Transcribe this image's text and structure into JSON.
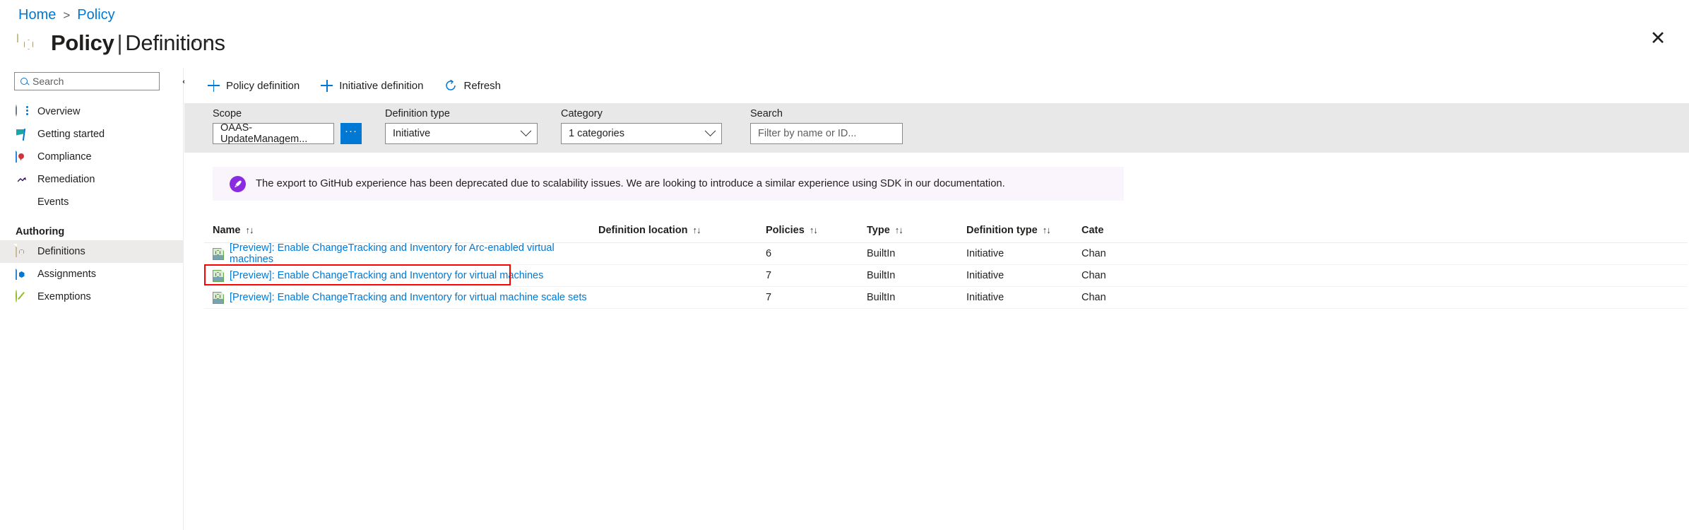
{
  "breadcrumb": {
    "home": "Home",
    "separator": ">",
    "current": "Policy"
  },
  "header": {
    "title_bold": "Policy",
    "title_sep": "|",
    "title_rest": "Definitions",
    "more_label": "···",
    "close_label": "✕",
    "icon": "policy-definition-icon"
  },
  "sidebar": {
    "search_placeholder": "Search",
    "collapse_label": "«",
    "items": [
      {
        "label": "Overview",
        "icon": "overview-icon",
        "selected": false
      },
      {
        "label": "Getting started",
        "icon": "flag-icon",
        "selected": false
      },
      {
        "label": "Compliance",
        "icon": "compliance-icon",
        "selected": false
      },
      {
        "label": "Remediation",
        "icon": "remediation-icon",
        "selected": false
      },
      {
        "label": "Events",
        "icon": "lightning-icon",
        "selected": false
      }
    ],
    "group_label": "Authoring",
    "authoring_items": [
      {
        "label": "Definitions",
        "icon": "definitions-icon",
        "selected": true
      },
      {
        "label": "Assignments",
        "icon": "assignments-icon",
        "selected": false
      },
      {
        "label": "Exemptions",
        "icon": "exemptions-icon",
        "selected": false
      }
    ]
  },
  "toolbar": {
    "policy_definition": "Policy definition",
    "initiative_definition": "Initiative definition",
    "refresh": "Refresh"
  },
  "filters": {
    "scope": {
      "label": "Scope",
      "value": "OAAS-UpdateManagem...",
      "browse_label": "···"
    },
    "definition_type": {
      "label": "Definition type",
      "value": "Initiative"
    },
    "category": {
      "label": "Category",
      "value": "1 categories"
    },
    "search": {
      "label": "Search",
      "placeholder": "Filter by name or ID..."
    }
  },
  "banner": {
    "icon": "rocket-icon",
    "text": "The export to GitHub experience has been deprecated due to scalability issues. We are looking to introduce a similar experience using SDK in our documentation.",
    "accent": "#8a2be2",
    "background": "#faf5fc"
  },
  "table": {
    "sort_glyph": "↑↓",
    "columns": [
      {
        "key": "name",
        "label": "Name"
      },
      {
        "key": "definition_location",
        "label": "Definition location"
      },
      {
        "key": "policies",
        "label": "Policies"
      },
      {
        "key": "type",
        "label": "Type"
      },
      {
        "key": "definition_type",
        "label": "Definition type"
      },
      {
        "key": "category",
        "label": "Cate"
      }
    ],
    "rows": [
      {
        "name": "[Preview]: Enable ChangeTracking and Inventory for Arc-enabled virtual machines",
        "definition_location": "",
        "policies": "6",
        "type": "BuiltIn",
        "definition_type": "Initiative",
        "category": "Chan",
        "highlighted": false
      },
      {
        "name": "[Preview]: Enable ChangeTracking and Inventory for virtual machines",
        "definition_location": "",
        "policies": "7",
        "type": "BuiltIn",
        "definition_type": "Initiative",
        "category": "Chan",
        "highlighted": true
      },
      {
        "name": "[Preview]: Enable ChangeTracking and Inventory for virtual machine scale sets",
        "definition_location": "",
        "policies": "7",
        "type": "BuiltIn",
        "definition_type": "Initiative",
        "category": "Chan",
        "highlighted": false
      }
    ]
  },
  "colors": {
    "link": "#0078d4",
    "highlight": "#ff0000",
    "filter_bar": "#e8e8e8",
    "selected_nav": "#edebe9"
  }
}
